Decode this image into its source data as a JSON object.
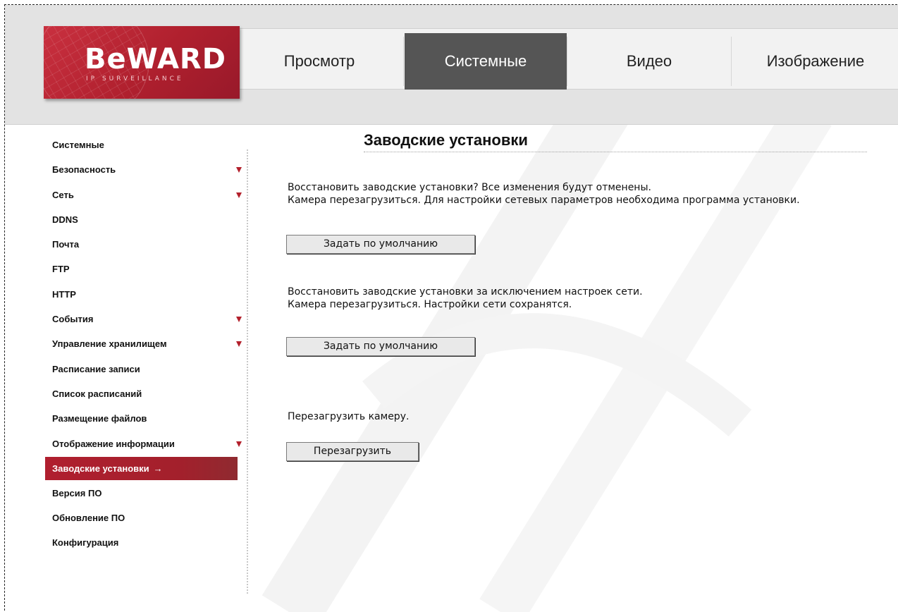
{
  "logo": {
    "brand": "BeWARD",
    "tagline": "IP SURVEILLANCE"
  },
  "nav": {
    "tabs": [
      {
        "label": "Просмотр",
        "active": false
      },
      {
        "label": "Системные",
        "active": true
      },
      {
        "label": "Видео",
        "active": false
      },
      {
        "label": "Изображение",
        "active": false
      }
    ]
  },
  "sidebar": {
    "items": [
      {
        "label": "Системные",
        "expandable": false
      },
      {
        "label": "Безопасность",
        "expandable": true
      },
      {
        "label": "Сеть",
        "expandable": true
      },
      {
        "label": "DDNS",
        "expandable": false
      },
      {
        "label": "Почта",
        "expandable": false
      },
      {
        "label": "FTP",
        "expandable": false
      },
      {
        "label": "HTTP",
        "expandable": false
      },
      {
        "label": "События",
        "expandable": true
      },
      {
        "label": "Управление хранилищем",
        "expandable": true
      },
      {
        "label": "Расписание записи",
        "expandable": false
      },
      {
        "label": "Список расписаний",
        "expandable": false
      },
      {
        "label": "Размещение файлов",
        "expandable": false
      },
      {
        "label": "Отображение информации",
        "expandable": true
      },
      {
        "label": "Заводские установки",
        "expandable": false,
        "active": true,
        "pointer": "→"
      },
      {
        "label": "Версия ПО",
        "expandable": false
      },
      {
        "label": "Обновление ПО",
        "expandable": false
      },
      {
        "label": "Конфигурация",
        "expandable": false
      }
    ]
  },
  "main": {
    "title": "Заводские установки",
    "section1": {
      "line1": "Восстановить заводские установки? Все изменения будут отменены.",
      "line2": "Камера перезагрузиться. Для настройки сетевых параметров необходима программа установки.",
      "button": "Задать по умолчанию"
    },
    "section2": {
      "line1": "Восстановить заводские установки за исключением настроек сети.",
      "line2": "Камера перезагрузиться. Настройки сети сохранятся.",
      "button": "Задать по умолчанию"
    },
    "section3": {
      "line1": "Перезагрузить камеру.",
      "button": "Перезагрузить"
    }
  },
  "colors": {
    "accent": "#b01f2f",
    "active_tab": "#555555",
    "header_bg": "#e3e3e3"
  }
}
